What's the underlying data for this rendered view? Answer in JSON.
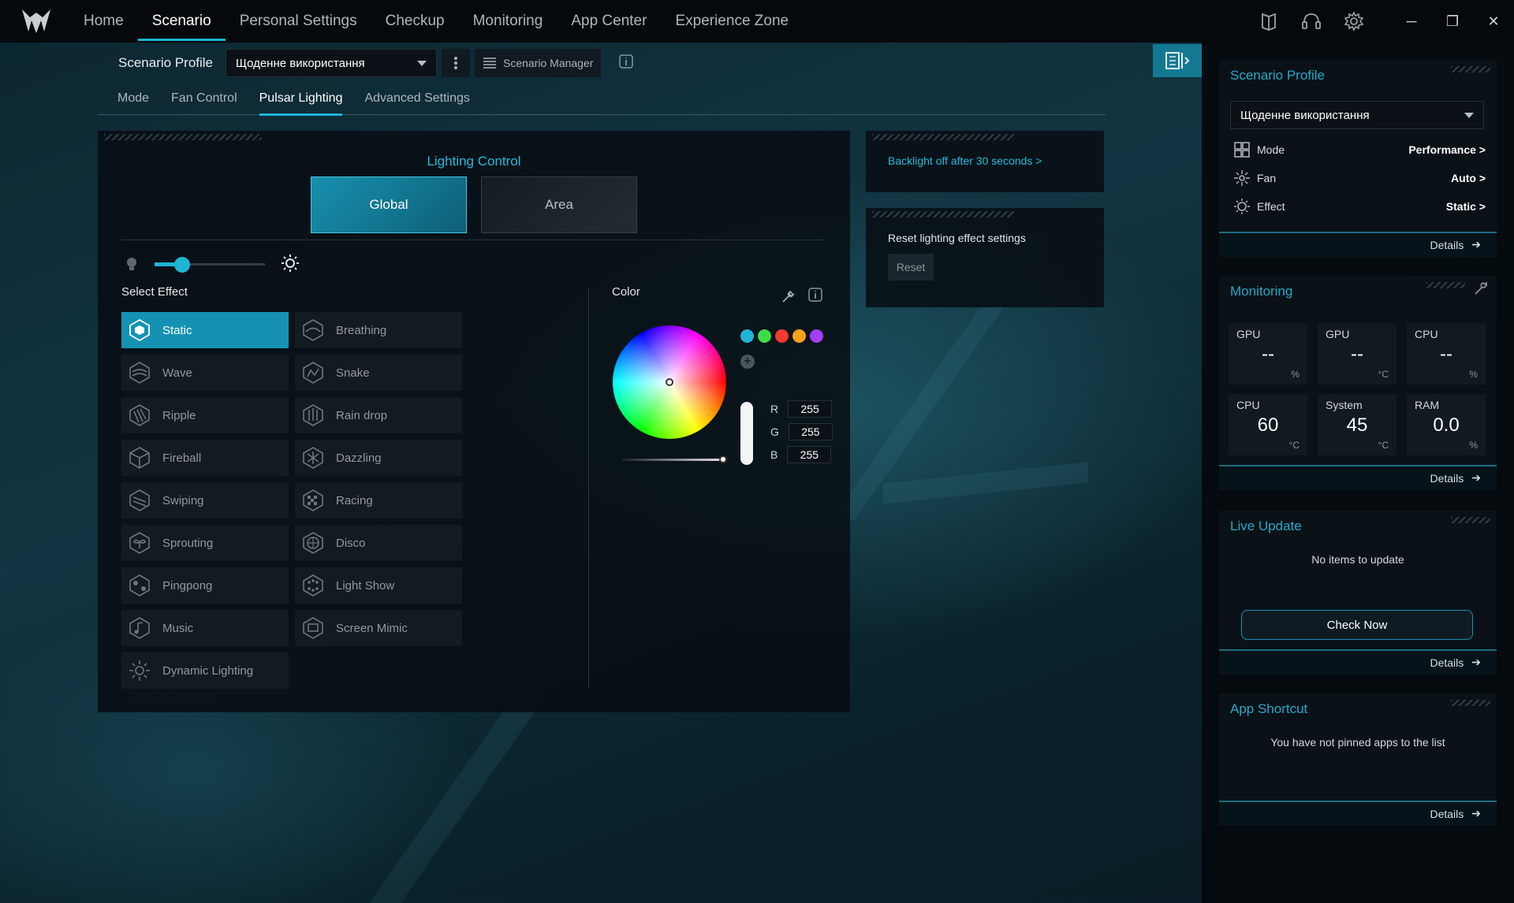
{
  "nav": {
    "items": [
      "Home",
      "Scenario",
      "Personal Settings",
      "Checkup",
      "Monitoring",
      "App Center",
      "Experience Zone"
    ],
    "active": "Scenario"
  },
  "profile": {
    "label": "Scenario Profile",
    "selected": "Щоденне використання",
    "manager_label": "Scenario Manager"
  },
  "subtabs": [
    "Mode",
    "Fan Control",
    "Pulsar Lighting",
    "Advanced Settings"
  ],
  "lighting": {
    "title": "Lighting Control",
    "global_label": "Global",
    "area_label": "Area",
    "brightness": 0.25,
    "select_effect_label": "Select Effect",
    "effects_col1": [
      "Static",
      "Wave",
      "Ripple",
      "Fireball",
      "Swiping",
      "Sprouting",
      "Pingpong",
      "Music",
      "Dynamic Lighting"
    ],
    "effects_col2": [
      "Breathing",
      "Snake",
      "Rain drop",
      "Dazzling",
      "Racing",
      "Disco",
      "Light Show",
      "Screen Mimic"
    ],
    "active_effect": "Static"
  },
  "color": {
    "label": "Color",
    "swatches": [
      "#1fb4d4",
      "#3ddc4a",
      "#f33a2f",
      "#f7a21b",
      "#a23ef5"
    ],
    "r_label": "R",
    "g_label": "G",
    "b_label": "B",
    "r": "255",
    "g": "255",
    "b": "255"
  },
  "side": {
    "backlight_text": "Backlight off after 30 seconds >",
    "reset_title": "Reset lighting effect settings",
    "reset_button": "Reset"
  },
  "right": {
    "scenario": {
      "title": "Scenario Profile",
      "selected": "Щоденне використання",
      "rows": [
        {
          "label": "Mode",
          "value": "Performance >"
        },
        {
          "label": "Fan",
          "value": "Auto >"
        },
        {
          "label": "Effect",
          "value": "Static >"
        }
      ],
      "details": "Details"
    },
    "monitoring": {
      "title": "Monitoring",
      "tiles": [
        {
          "title": "GPU",
          "value": "--",
          "unit": "%"
        },
        {
          "title": "GPU",
          "value": "--",
          "unit": "°C"
        },
        {
          "title": "CPU",
          "value": "--",
          "unit": "%"
        },
        {
          "title": "CPU",
          "value": "60",
          "unit": "°C"
        },
        {
          "title": "System",
          "value": "45",
          "unit": "°C"
        },
        {
          "title": "RAM",
          "value": "0.0",
          "unit": "%"
        }
      ],
      "details": "Details"
    },
    "live_update": {
      "title": "Live Update",
      "message": "No items to update",
      "button": "Check Now",
      "details": "Details"
    },
    "app_shortcut": {
      "title": "App Shortcut",
      "message": "You have not pinned apps to the list",
      "details": "Details"
    }
  }
}
